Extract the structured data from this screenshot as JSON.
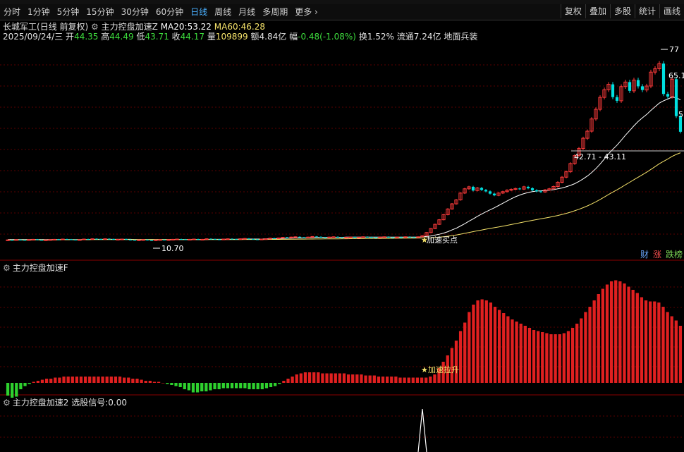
{
  "toolbar": {
    "periods": [
      "分时",
      "1分钟",
      "5分钟",
      "15分钟",
      "30分钟",
      "60分钟",
      "日线",
      "周线",
      "月线",
      "多周期",
      "更多"
    ],
    "active": "日线",
    "more_icon": "chevron-right-icon",
    "right_buttons": [
      "复权",
      "叠加",
      "多股",
      "统计",
      "画线"
    ]
  },
  "stock": {
    "name": "长城军工",
    "mode": "(日线 前复权)",
    "indicator_name": "主力控盘加速Z",
    "ma20_label": "MA20:",
    "ma20_value": "53.22",
    "ma60_label": "MA60:",
    "ma60_value": "46.28"
  },
  "quote": {
    "date": "2025/09/24/三",
    "open_label": "开",
    "open": "44.35",
    "high_label": "高",
    "high": "44.49",
    "low_label": "低",
    "low": "43.71",
    "close_label": "收",
    "close": "44.17",
    "vol_label": "量",
    "vol": "109899",
    "amount_label": "额",
    "amount": "4.84亿",
    "change_label": "幅",
    "change": "-0.48(-1.08%)",
    "turnover_label": "换",
    "turnover": "1.52%",
    "float_label": "流通",
    "float": "7.24亿",
    "sector": "地面兵装"
  },
  "annotations": {
    "low_price": "10.70",
    "high_price": "77",
    "mid_price": "65.1",
    "range_label": "42.71 - 43.11",
    "side_price": "5",
    "buy_signal": "加速买点",
    "accel_label": "加速拉升"
  },
  "panel2": {
    "title": "主力控盘加速F"
  },
  "panel3": {
    "title": "主力控盘加速2",
    "signal_label": "选股信号:",
    "signal_value": "0.00"
  },
  "tags": [
    "财",
    "涨",
    "跌榜"
  ],
  "colors": {
    "up": "#ff3b3b",
    "down": "#00e0e0",
    "ma20": "#ffffff",
    "ma60": "#f5e26a",
    "grid": "#5a0000",
    "macd_neg": "#2ed12e"
  },
  "chart_data": [
    {
      "type": "candlestick",
      "x_note": "daily bars, oldest to newest",
      "ylim": [
        5,
        80
      ],
      "close": [
        10.9,
        10.8,
        11.0,
        10.9,
        10.8,
        11.0,
        11.1,
        10.9,
        10.8,
        10.9,
        11.0,
        11.1,
        11.0,
        11.2,
        11.1,
        11.0,
        10.9,
        11.0,
        11.2,
        11.1,
        11.3,
        11.2,
        11.1,
        11.3,
        11.2,
        11.0,
        11.1,
        11.2,
        11.0,
        10.9,
        10.8,
        10.9,
        11.0,
        10.8,
        10.7,
        10.9,
        11.0,
        10.9,
        11.0,
        11.1,
        11.2,
        11.1,
        11.0,
        11.1,
        11.2,
        11.0,
        11.1,
        11.3,
        11.2,
        11.1,
        11.0,
        11.2,
        11.3,
        11.2,
        11.1,
        11.3,
        11.4,
        11.2,
        11.1,
        11.0,
        11.2,
        11.3,
        11.5,
        11.4,
        11.6,
        11.8,
        11.7,
        11.9,
        12.0,
        11.8,
        11.7,
        11.9,
        12.1,
        12.0,
        11.8,
        11.7,
        11.9,
        12.0,
        11.8,
        11.7,
        11.8,
        11.9,
        11.7,
        11.8,
        12.0,
        11.9,
        11.8,
        11.7,
        11.9,
        12.0,
        11.8,
        11.7,
        11.9,
        11.8,
        12.0,
        11.9,
        11.8,
        12.0,
        12.4,
        13.5,
        14.9,
        16.4,
        18.0,
        19.8,
        21.8,
        23.6,
        25.0,
        27.4,
        28.9,
        29.6,
        28.3,
        29.2,
        28.5,
        28.0,
        27.2,
        26.6,
        27.4,
        27.9,
        28.4,
        28.7,
        29.0,
        28.8,
        29.6,
        29.1,
        28.4,
        28.0,
        27.8,
        28.5,
        28.9,
        29.7,
        31.2,
        33.0,
        34.9,
        37.8,
        40.6,
        43.1,
        46.7,
        49.2,
        53.5,
        56.9,
        61.1,
        63.8,
        65.7,
        61.2,
        59.9,
        64.9,
        66.5,
        63.4,
        67.2,
        65.0,
        63.7,
        65.1,
        70.0,
        71.2,
        73.0,
        62.3,
        61.4,
        67.5,
        54.5,
        49.0
      ],
      "ma20": [
        11.0,
        11.0,
        11.0,
        11.0,
        11.0,
        11.0,
        11.0,
        11.0,
        11.0,
        11.0,
        11.0,
        11.0,
        11.0,
        11.0,
        11.0,
        11.0,
        11.0,
        11.0,
        11.0,
        11.0,
        11.1,
        11.1,
        11.1,
        11.1,
        11.1,
        11.1,
        11.1,
        11.1,
        11.1,
        11.1,
        11.0,
        11.0,
        11.0,
        11.0,
        11.0,
        11.0,
        11.0,
        11.0,
        11.0,
        11.0,
        11.0,
        11.0,
        11.0,
        11.0,
        11.0,
        11.0,
        11.0,
        11.0,
        11.1,
        11.1,
        11.1,
        11.1,
        11.1,
        11.1,
        11.1,
        11.2,
        11.2,
        11.2,
        11.2,
        11.2,
        11.2,
        11.3,
        11.3,
        11.3,
        11.4,
        11.4,
        11.5,
        11.5,
        11.6,
        11.6,
        11.6,
        11.7,
        11.7,
        11.8,
        11.8,
        11.8,
        11.8,
        11.8,
        11.8,
        11.8,
        11.9,
        11.9,
        11.9,
        11.9,
        11.9,
        11.9,
        11.9,
        11.9,
        11.9,
        11.9,
        11.9,
        11.9,
        11.9,
        11.9,
        11.9,
        11.9,
        11.9,
        11.9,
        12.0,
        12.1,
        12.3,
        12.6,
        12.9,
        13.3,
        13.8,
        14.4,
        15.0,
        15.8,
        16.6,
        17.5,
        18.3,
        19.2,
        20.0,
        20.8,
        21.5,
        22.2,
        23.0,
        23.8,
        24.6,
        25.4,
        26.1,
        26.7,
        27.2,
        27.6,
        27.9,
        28.1,
        28.2,
        28.3,
        28.4,
        28.6,
        28.9,
        29.2,
        29.6,
        30.1,
        30.7,
        31.5,
        32.4,
        33.4,
        34.6,
        36.0,
        37.6,
        39.4,
        41.2,
        42.8,
        44.3,
        46.0,
        47.8,
        49.4,
        51.1,
        52.6,
        53.9,
        55.1,
        56.5,
        57.8,
        59.1,
        59.9,
        60.5,
        61.2,
        61.0,
        60.2
      ]
    },
    {
      "type": "bar",
      "title": "主力控盘加速F",
      "note": "red above zero, green below zero",
      "values": [
        -12,
        -14,
        -13,
        -6,
        -3,
        -1,
        1,
        2,
        3,
        4,
        4,
        5,
        5,
        6,
        6,
        6,
        6,
        6,
        6,
        6,
        6,
        6,
        6,
        6,
        6,
        6,
        6,
        5,
        5,
        4,
        4,
        3,
        2,
        2,
        1,
        1,
        0,
        -1,
        -2,
        -3,
        -4,
        -6,
        -7,
        -9,
        -9,
        -8,
        -8,
        -7,
        -6,
        -6,
        -5,
        -5,
        -5,
        -5,
        -5,
        -5,
        -6,
        -6,
        -6,
        -6,
        -5,
        -4,
        -3,
        -1,
        2,
        4,
        6,
        8,
        9,
        10,
        10,
        10,
        10,
        9,
        9,
        9,
        9,
        9,
        9,
        8,
        8,
        8,
        8,
        7,
        7,
        7,
        6,
        6,
        6,
        6,
        6,
        5,
        5,
        5,
        5,
        5,
        5,
        5,
        6,
        8,
        14,
        20,
        26,
        33,
        40,
        49,
        57,
        67,
        74,
        78,
        79,
        78,
        76,
        72,
        69,
        66,
        63,
        60,
        58,
        56,
        54,
        52,
        50,
        49,
        48,
        47,
        46,
        46,
        46,
        47,
        49,
        52,
        56,
        61,
        67,
        72,
        78,
        84,
        89,
        93,
        96,
        97,
        96,
        94,
        91,
        88,
        85,
        81,
        78,
        77,
        77,
        76,
        72,
        67,
        63,
        59,
        54
      ]
    }
  ]
}
